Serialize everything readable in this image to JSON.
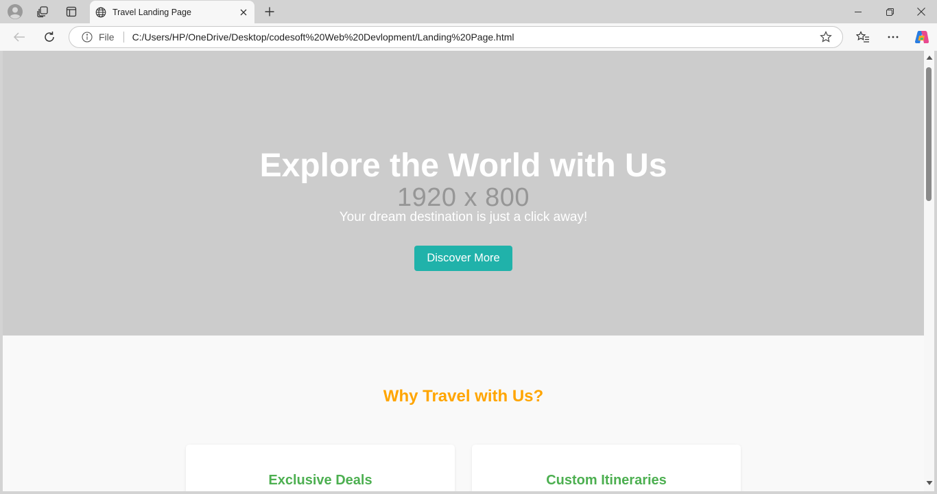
{
  "browser": {
    "tab": {
      "title": "Travel Landing Page"
    },
    "address_bar": {
      "scheme_label": "File",
      "url": "C:/Users/HP/OneDrive/Desktop/codesoft%20Web%20Devlopment/Landing%20Page.html"
    },
    "icons": [
      "profile-icon",
      "workspaces-icon",
      "tab-actions-icon",
      "globe-icon",
      "close-icon",
      "plus-icon",
      "minimize-icon",
      "restore-icon",
      "close-window-icon",
      "back-icon",
      "refresh-icon",
      "info-icon",
      "star-icon",
      "favorites-icon",
      "more-icon",
      "copilot-icon"
    ]
  },
  "hero": {
    "placeholder_text": "1920 x 800",
    "title": "Explore the World with Us",
    "subtitle": "Your dream destination is just a click away!",
    "button_label": "Discover More"
  },
  "features": {
    "title": "Why Travel with Us?",
    "cards": [
      {
        "title": "Exclusive Deals"
      },
      {
        "title": "Custom Itineraries"
      }
    ]
  },
  "colors": {
    "hero_bg": "#cccccc",
    "button_bg": "#20b2aa",
    "section_title": "#ffa500",
    "card_title": "#4caf50"
  }
}
